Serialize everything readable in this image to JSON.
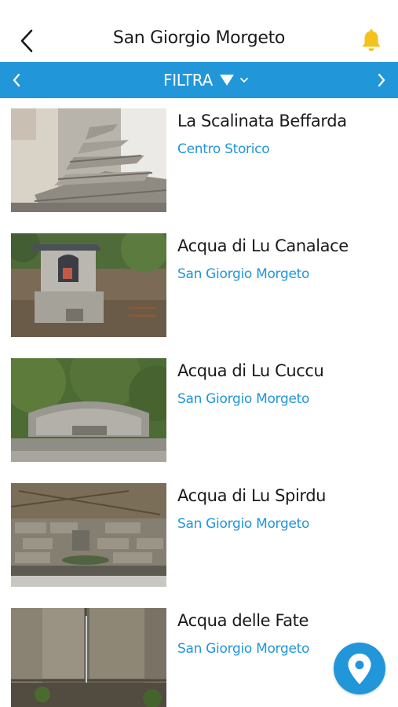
{
  "header": {
    "title": "San Giorgio Morgeto",
    "back_icon": "chevron-left-icon",
    "notification_icon": "bell-icon"
  },
  "filter_bar": {
    "label": "FILTRA",
    "filter_icon": "funnel-icon",
    "dropdown_icon": "chevron-down-icon",
    "prev_icon": "chevron-left-icon",
    "next_icon": "chevron-right-icon"
  },
  "items": [
    {
      "title": "La Scalinata Beffarda",
      "subtitle": "Centro Storico"
    },
    {
      "title": "Acqua di Lu Canalace",
      "subtitle": "San Giorgio Morgeto"
    },
    {
      "title": "Acqua di Lu Cuccu",
      "subtitle": "San Giorgio Morgeto"
    },
    {
      "title": "Acqua di Lu Spirdu",
      "subtitle": "San Giorgio Morgeto"
    },
    {
      "title": "Acqua delle Fate",
      "subtitle": "San Giorgio Morgeto"
    }
  ],
  "map_button": {
    "icon": "map-pin-icon"
  },
  "colors": {
    "accent": "#2196d9",
    "bell": "#f5c21b",
    "text": "#1a1a1a",
    "background": "#ffffff"
  }
}
